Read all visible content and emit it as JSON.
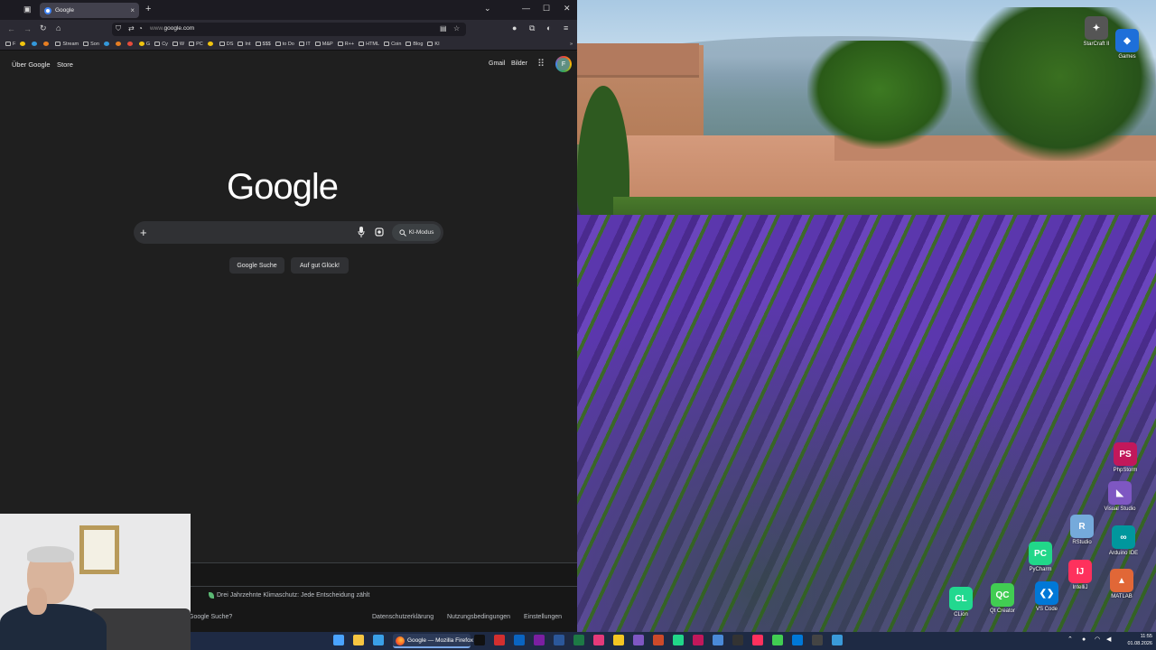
{
  "browser": {
    "tab": {
      "title": "Google",
      "close": "×"
    },
    "new_tab": "+",
    "url": {
      "prefix": "www.",
      "domain": "google.com"
    },
    "bookmarks": [
      {
        "label": "F",
        "icon": "folder-icon"
      },
      {
        "label": "",
        "icon": "bookmark-icon"
      },
      {
        "label": "",
        "icon": "youtube-icon"
      },
      {
        "label": "",
        "icon": "bookmark-icon"
      },
      {
        "label": "Stream",
        "icon": "folder-icon"
      },
      {
        "label": "Son",
        "icon": "folder-icon"
      },
      {
        "label": "",
        "icon": "bookmark-icon"
      },
      {
        "label": "",
        "icon": "bookmark-icon"
      },
      {
        "label": "",
        "icon": "bookmark-icon"
      },
      {
        "label": "G",
        "icon": "bookmark-icon"
      },
      {
        "label": "Cy",
        "icon": "folder-icon"
      },
      {
        "label": "W",
        "icon": "folder-icon"
      },
      {
        "label": "PC",
        "icon": "folder-icon"
      },
      {
        "label": "",
        "icon": "bookmark-icon"
      },
      {
        "label": "DS",
        "icon": "folder-icon"
      },
      {
        "label": "Int",
        "icon": "folder-icon"
      },
      {
        "label": "$$$",
        "icon": "folder-icon"
      },
      {
        "label": "to Do",
        "icon": "folder-icon"
      },
      {
        "label": "IT",
        "icon": "folder-icon"
      },
      {
        "label": "M&P",
        "icon": "folder-icon"
      },
      {
        "label": "R++",
        "icon": "folder-icon"
      },
      {
        "label": "HTML",
        "icon": "folder-icon"
      },
      {
        "label": "Coin",
        "icon": "folder-icon"
      },
      {
        "label": "Blog",
        "icon": "folder-icon"
      },
      {
        "label": "KI",
        "icon": "folder-icon"
      }
    ],
    "bookmarks_more": "»"
  },
  "google": {
    "about": "Über Google",
    "store": "Store",
    "gmail": "Gmail",
    "images": "Bilder",
    "avatar_letter": "F",
    "logo": "Google",
    "plus": "+",
    "ai_mode": "KI-Modus",
    "search_button": "Google Suche",
    "lucky_button": "Auf gut Glück!",
    "footer_climate": "Drei Jahrzehnte Klimaschutz: Jede Entscheidung zählt",
    "footer_how": "Google Suche?",
    "footer_privacy": "Datenschutzerklärung",
    "footer_terms": "Nutzungsbedingungen",
    "footer_settings": "Einstellungen"
  },
  "desktop_icons": [
    {
      "label": "StarCraft II",
      "color": "#555555",
      "glyph": "✦"
    },
    {
      "label": "Games",
      "color": "#1e6fd9",
      "glyph": "◆"
    },
    {
      "label": "PhpStorm",
      "color": "#c2185b",
      "glyph": "PS"
    },
    {
      "label": "Visual Studio",
      "color": "#7e57c2",
      "glyph": "◣"
    },
    {
      "label": "RStudio",
      "color": "#75aadb",
      "glyph": "R"
    },
    {
      "label": "Arduino IDE",
      "color": "#00979d",
      "glyph": "∞"
    },
    {
      "label": "PyCharm",
      "color": "#21d789",
      "glyph": "PC"
    },
    {
      "label": "IntelliJ",
      "color": "#fe315d",
      "glyph": "IJ"
    },
    {
      "label": "MATLAB",
      "color": "#e16737",
      "glyph": "▲"
    },
    {
      "label": "CLion",
      "color": "#22d88f",
      "glyph": "CL"
    },
    {
      "label": "Qt Creator",
      "color": "#41cd52",
      "glyph": "QC"
    },
    {
      "label": "VS Code",
      "color": "#0078d7",
      "glyph": "❮❯"
    }
  ],
  "taskbar": {
    "firefox_label": "Google — Mozilla Firefox",
    "time": "11:55",
    "date": "01.08.2026",
    "apps": [
      {
        "name": "start-icon",
        "color": "#4aa3ff"
      },
      {
        "name": "file-explorer-icon",
        "color": "#f5c542"
      },
      {
        "name": "desktop-icon",
        "color": "#3aa0e8"
      },
      {
        "name": "apple-tv-icon",
        "color": "#111111"
      },
      {
        "name": "pdf-icon",
        "color": "#d32f2f"
      },
      {
        "name": "outlook-icon",
        "color": "#0a64c2"
      },
      {
        "name": "onenote-icon",
        "color": "#7b1fa2"
      },
      {
        "name": "word-icon",
        "color": "#2b579a"
      },
      {
        "name": "excel-icon",
        "color": "#1d7a45"
      },
      {
        "name": "itunes-icon",
        "color": "#e53a7a"
      },
      {
        "name": "sticky-notes-icon",
        "color": "#f3c623"
      },
      {
        "name": "visual-studio-icon",
        "color": "#7e57c2"
      },
      {
        "name": "tool-icon",
        "color": "#cc4a2a"
      },
      {
        "name": "pycharm-icon",
        "color": "#21d789"
      },
      {
        "name": "phpstorm-icon",
        "color": "#c2185b"
      },
      {
        "name": "notepad-icon",
        "color": "#4a8ad8"
      },
      {
        "name": "terminal-icon",
        "color": "#333333"
      },
      {
        "name": "intellij-icon",
        "color": "#fe315d"
      },
      {
        "name": "qt-icon",
        "color": "#41cd52"
      },
      {
        "name": "vscode-icon",
        "color": "#0078d7"
      },
      {
        "name": "github-icon",
        "color": "#444444"
      },
      {
        "name": "globe-icon",
        "color": "#3a9ad9"
      }
    ]
  }
}
